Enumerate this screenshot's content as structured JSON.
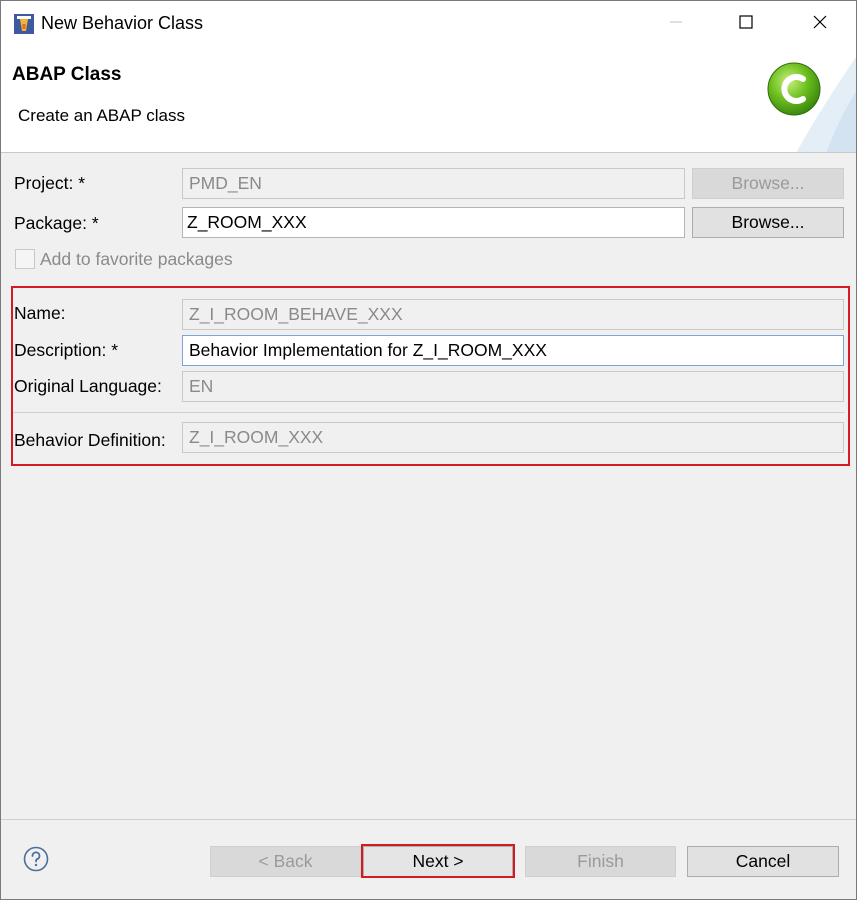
{
  "window": {
    "title": "New Behavior Class"
  },
  "banner": {
    "title": "ABAP Class",
    "subtitle": "Create an ABAP class"
  },
  "form": {
    "project": {
      "label": "Project: *",
      "value": "PMD_EN",
      "browse_label": "Browse..."
    },
    "package": {
      "label": "Package: *",
      "value": "Z_ROOM_XXX",
      "browse_label": "Browse..."
    },
    "favorite": {
      "label": "Add to favorite packages",
      "checked": false
    },
    "name": {
      "label": "Name:",
      "value": "Z_I_ROOM_BEHAVE_XXX"
    },
    "description": {
      "label": "Description: *",
      "value": "Behavior Implementation for Z_I_ROOM_XXX"
    },
    "language": {
      "label": "Original Language:",
      "value": "EN"
    },
    "behavior_definition": {
      "label": "Behavior Definition:",
      "value": "Z_I_ROOM_XXX"
    }
  },
  "footer": {
    "back_label": "< Back",
    "next_label": "Next >",
    "finish_label": "Finish",
    "cancel_label": "Cancel"
  },
  "icons": {
    "app": "eclipse-abap-icon",
    "help": "help-icon",
    "class_badge": "abap-class-icon"
  },
  "colors": {
    "highlight": "#d71920",
    "badge_green": "#6cbf1f"
  }
}
